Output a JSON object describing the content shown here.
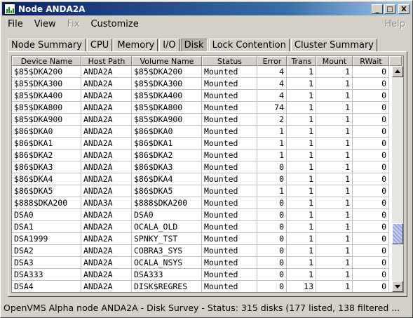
{
  "window": {
    "title": "Node ANDA2A",
    "minimize_label": "_",
    "maximize_label": "□",
    "close_label": "X"
  },
  "menu": {
    "file": "File",
    "view": "View",
    "fix": "Fix",
    "customize": "Customize",
    "help": "Help"
  },
  "tabs": [
    "Node Summary",
    "CPU",
    "Memory",
    "I/O",
    "Disk",
    "Lock Contention",
    "Cluster Summary"
  ],
  "active_tab": "Disk",
  "table": {
    "columns": [
      "Device Name",
      "Host Path",
      "Volume Name",
      "Status",
      "Error",
      "Trans",
      "Mount",
      "RWait"
    ],
    "rows": [
      [
        "$85$DKA200",
        "ANDA2A",
        "$85$DKA200",
        "Mounted",
        "4",
        "1",
        "1",
        "0"
      ],
      [
        "$85$DKA300",
        "ANDA2A",
        "$85$DKA300",
        "Mounted",
        "4",
        "1",
        "1",
        "0"
      ],
      [
        "$85$DKA400",
        "ANDA2A",
        "$85$DKA400",
        "Mounted",
        "4",
        "1",
        "1",
        "0"
      ],
      [
        "$85$DKA800",
        "ANDA2A",
        "$85$DKA800",
        "Mounted",
        "74",
        "1",
        "1",
        "0"
      ],
      [
        "$85$DKA900",
        "ANDA2A",
        "$85$DKA900",
        "Mounted",
        "2",
        "1",
        "1",
        "0"
      ],
      [
        "$86$DKA0",
        "ANDA2A",
        "$86$DKA0",
        "Mounted",
        "1",
        "1",
        "1",
        "0"
      ],
      [
        "$86$DKA1",
        "ANDA2A",
        "$86$DKA1",
        "Mounted",
        "1",
        "1",
        "1",
        "0"
      ],
      [
        "$86$DKA2",
        "ANDA2A",
        "$86$DKA2",
        "Mounted",
        "1",
        "1",
        "1",
        "0"
      ],
      [
        "$86$DKA3",
        "ANDA2A",
        "$86$DKA3",
        "Mounted",
        "0",
        "1",
        "1",
        "0"
      ],
      [
        "$86$DKA4",
        "ANDA2A",
        "$86$DKA4",
        "Mounted",
        "0",
        "1",
        "1",
        "0"
      ],
      [
        "$86$DKA5",
        "ANDA2A",
        "$86$DKA5",
        "Mounted",
        "1",
        "1",
        "1",
        "0"
      ],
      [
        "$888$DKA200",
        "ANDA3A",
        "$888$DKA200",
        "Mounted",
        "0",
        "1",
        "1",
        "0"
      ],
      [
        "DSA0",
        "ANDA2A",
        "DSA0",
        "Mounted",
        "0",
        "1",
        "1",
        "0"
      ],
      [
        "DSA1",
        "ANDA2A",
        "OCALA_OLD",
        "Mounted",
        "0",
        "1",
        "1",
        "0"
      ],
      [
        "DSA1999",
        "ANDA2A",
        "SPNKY_TST",
        "Mounted",
        "0",
        "1",
        "1",
        "0"
      ],
      [
        "DSA2",
        "ANDA2A",
        "COBRA3_SYS",
        "Mounted",
        "0",
        "1",
        "1",
        "0"
      ],
      [
        "DSA3",
        "ANDA2A",
        "OCALA_NSYS",
        "Mounted",
        "0",
        "1",
        "1",
        "0"
      ],
      [
        "DSA333",
        "ANDA2A",
        "DSA333",
        "Mounted",
        "0",
        "1",
        "1",
        "0"
      ],
      [
        "DSA4",
        "ANDA2A",
        "DISK$REGRES",
        "Mounted",
        "0",
        "13",
        "1",
        "0"
      ]
    ]
  },
  "status": {
    "text": "OpenVMS Alpha node ANDA2A - Disk Survey - Status:  315 disks (177 listed, 138 filtered ..."
  }
}
